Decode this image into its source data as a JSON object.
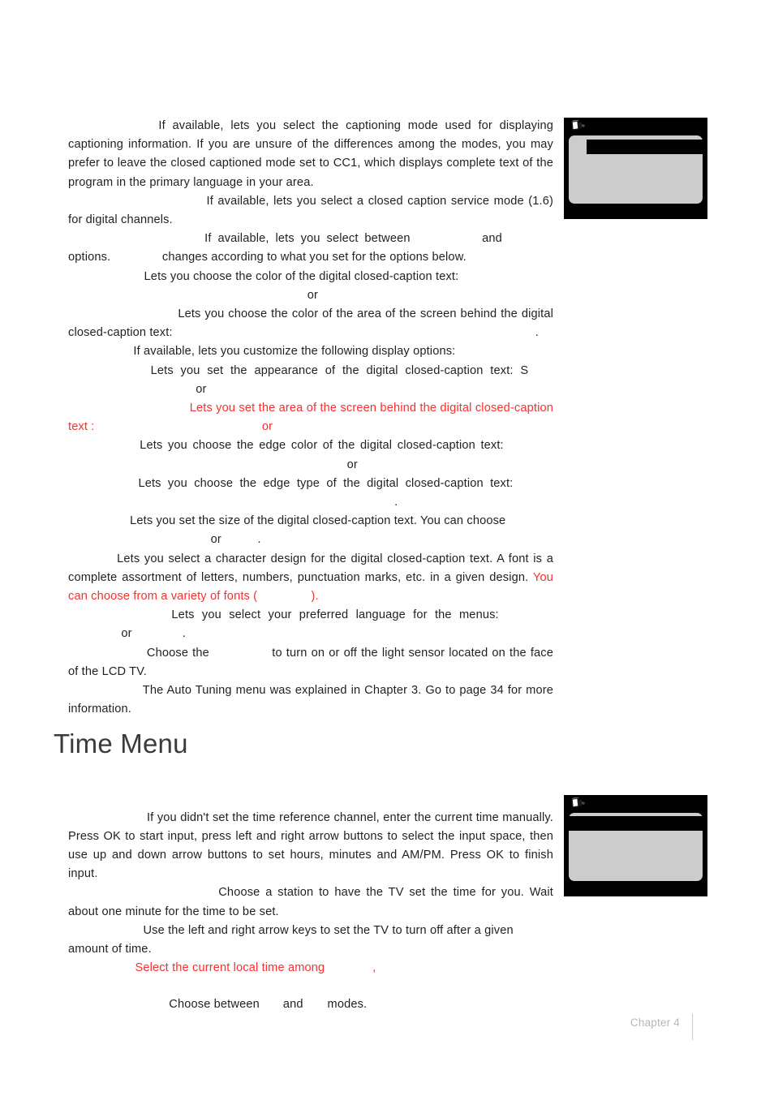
{
  "document": {
    "type": "tv-user-manual-page",
    "footer": {
      "chapter_label": "Chapter 4"
    },
    "colors": {
      "body_text": "#231f20",
      "red_text": "#fb2e2e",
      "heading": "#3b3b3b",
      "footer": "#b6b6b6",
      "osd_border": "#000000",
      "osd_panel": "#cccccc",
      "osd_highlight": "#000000"
    }
  },
  "paragraphs": {
    "p1": "If available, lets you select the captioning mode used for displaying captioning information. If you are unsure of the differences among the modes, you may prefer to leave the closed captioned mode set to CC1, which displays complete text of the program in the primary language in your area.",
    "p2": "If available, lets you select a closed caption service mode (1.6) for digital channels.",
    "p3a": "If available, lets you select between",
    "p3b": "and",
    "p3c": "options.",
    "p3d": "changes according to what you set for the options below.",
    "p4a": "Lets you choose the color of the digital closed-caption text:",
    "p4b": "or",
    "p5a": "Lets you choose the color of the area of the screen behind the digital closed-caption text:",
    "p5b": ".",
    "p6": "If available, lets you customize the following display options:",
    "p7a": "Lets you set the appearance of the digital closed-caption text:",
    "p7b": "S",
    "p7c": "or",
    "p8a": "Lets you set the area of the screen behind the digital closed-caption text :",
    "p8b": "or",
    "p9a": "Lets you choose the edge color of the  digital closed-caption text:",
    "p9b": "or",
    "p10a": "Lets you choose the edge type of the  digital closed-caption text:",
    "p10b": ".",
    "p11a": "Lets you set the size of the digital closed-caption text. You can choose",
    "p11b": "or",
    "p11c": ".",
    "p12a": "Lets you select a character design for the digital closed-caption text. A font is a complete assortment of letters, numbers, punctuation marks, etc. in a given design.",
    "p12b": "You can choose from a variety of fonts (",
    "p12c": ").",
    "p13a": "Lets you select your preferred language for the menus:",
    "p13b": "or",
    "p13c": ".",
    "p14": "Choose the",
    "p14b": "to turn on or off the light sensor located on the face of the LCD TV.",
    "p15": "The Auto Tuning menu was explained in Chapter 3. Go to page 34 for more information."
  },
  "time_menu": {
    "heading": "Time Menu",
    "p1": "If you didn't set the time reference channel, enter the current time manually. Press OK to start input, press left and right arrow buttons to select the input space, then use up and down arrow buttons to set hours, minutes and AM/PM. Press OK to finish input.",
    "p2": "Choose a station to have the TV set the time for you. Wait about one minute for the time to be set.",
    "p3": "Use the left and right arrow keys to set the TV to turn off after a given amount of time.",
    "p4a": "Select the current local time among",
    "p4b": ",",
    "p5a": "Choose between",
    "p5b": "and",
    "p5c": "modes."
  },
  "osd_images": {
    "top": {
      "caption": "closed-caption-settings-menu"
    },
    "bottom": {
      "caption": "time-settings-menu"
    }
  }
}
